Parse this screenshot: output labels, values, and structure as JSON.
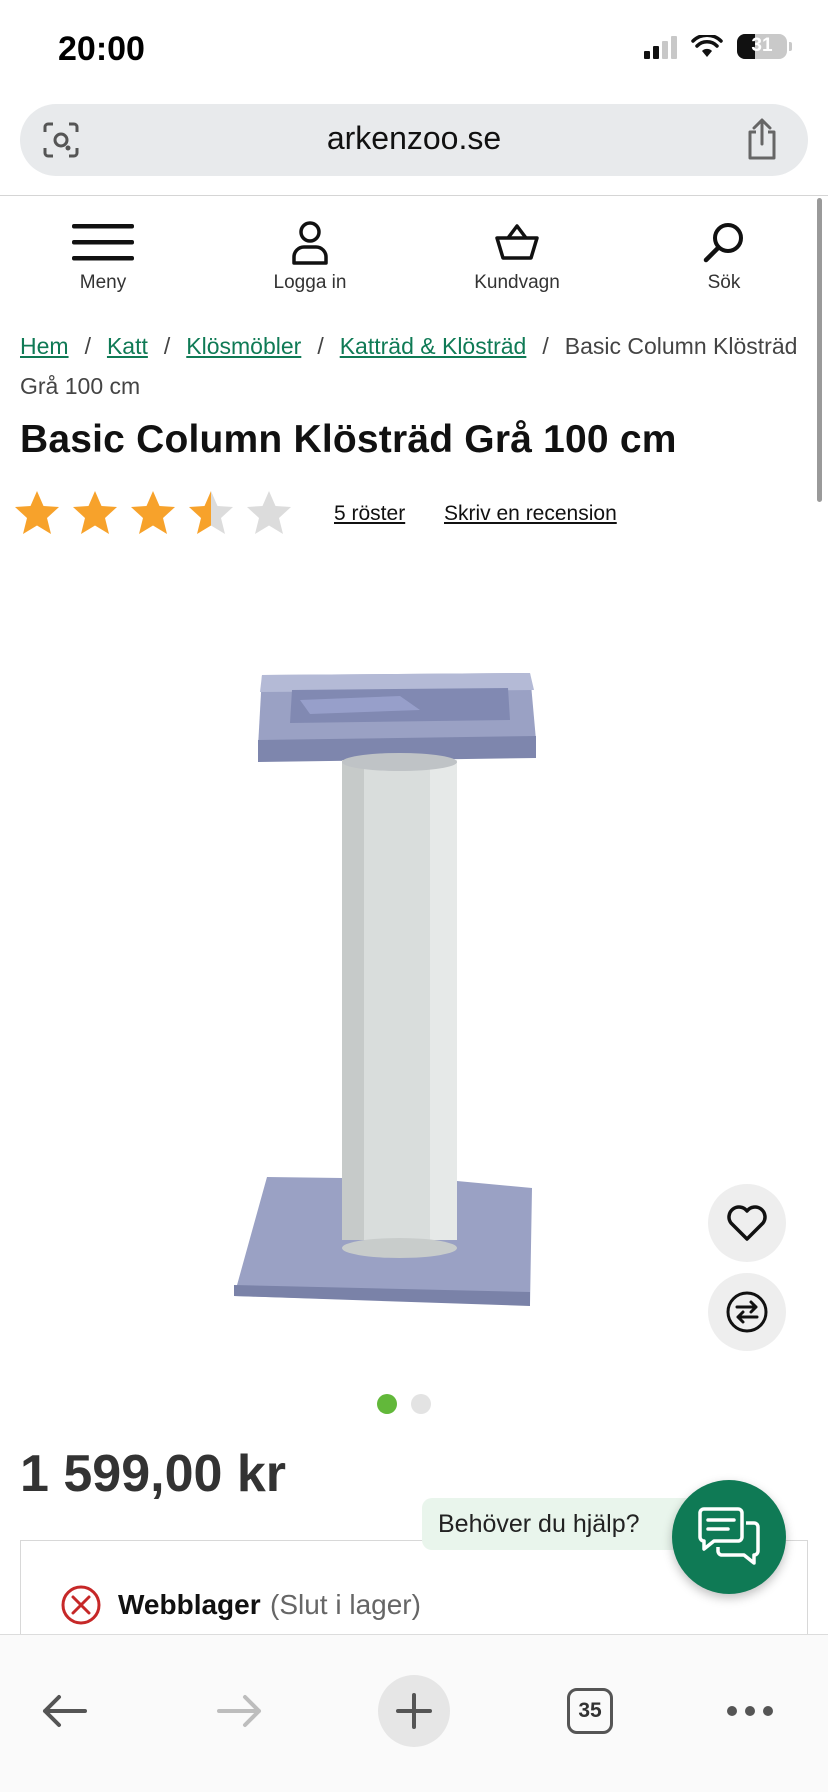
{
  "status_bar": {
    "time": "20:00",
    "battery": "31"
  },
  "browser": {
    "url": "arkenzoo.se",
    "tabs_count": "35"
  },
  "site_nav": {
    "menu_label": "Meny",
    "login_label": "Logga in",
    "cart_label": "Kundvagn",
    "search_label": "Sök"
  },
  "breadcrumb": {
    "items": [
      "Hem",
      "Katt",
      "Klösmöbler",
      "Katträd & Klösträd"
    ],
    "current": "Basic Column Klösträd Grå 100 cm",
    "separator": "/"
  },
  "product": {
    "title": "Basic Column Klösträd Grå 100 cm",
    "rating": 3.5,
    "rating_max": 5,
    "votes_label": "5 röster",
    "review_label": "Skriv en recension",
    "price": "1 599,00 kr",
    "image_count": 2,
    "active_image": 0
  },
  "stock": {
    "label": "Webblager",
    "status": "(Slut i lager)"
  },
  "help": {
    "text": "Behöver du hjälp?"
  },
  "colors": {
    "brand_green": "#0f7a55",
    "star": "#f7a22b",
    "dot_active": "#62b83a"
  }
}
